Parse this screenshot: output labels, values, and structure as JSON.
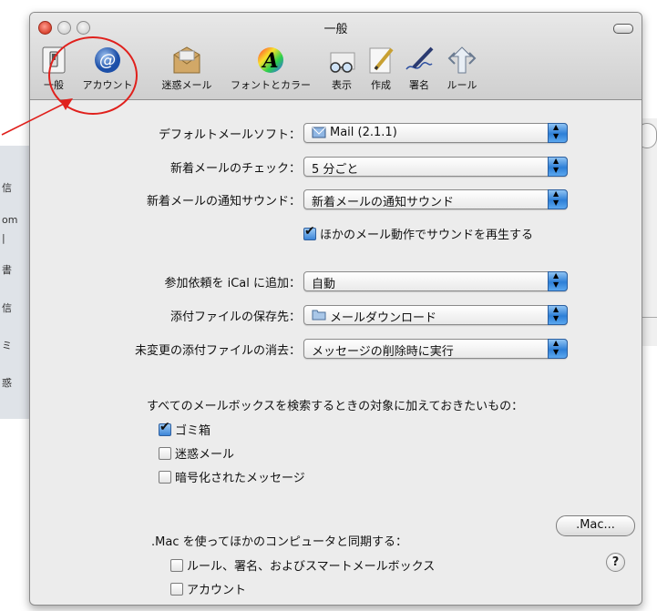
{
  "window": {
    "title": "一般"
  },
  "toolbar": {
    "items": [
      {
        "label": "一般",
        "icon": "general-switch-icon"
      },
      {
        "label": "アカウント",
        "icon": "at-sign-icon"
      },
      {
        "label": "迷惑メール",
        "icon": "junk-mail-icon"
      },
      {
        "label": "フォントとカラー",
        "icon": "fonts-colors-icon"
      },
      {
        "label": "表示",
        "icon": "viewing-glasses-icon"
      },
      {
        "label": "作成",
        "icon": "composing-pencil-icon"
      },
      {
        "label": "署名",
        "icon": "signature-pen-icon"
      },
      {
        "label": "ルール",
        "icon": "rules-arrows-icon"
      }
    ]
  },
  "settings": {
    "default_mail": {
      "label": "デフォルトメールソフト：",
      "value": "Mail (2.1.1)"
    },
    "check_mail": {
      "label": "新着メールのチェック：",
      "value": "5 分ごと"
    },
    "new_mail_sound": {
      "label": "新着メールの通知サウンド：",
      "value": "新着メールの通知サウンド"
    },
    "play_sounds": {
      "label": "ほかのメール動作でサウンドを再生する",
      "checked": true
    },
    "add_invitations": {
      "label": "参加依頼を iCal に追加：",
      "value": "自動"
    },
    "downloads_folder": {
      "label": "添付ファイルの保存先：",
      "value": "メールダウンロード"
    },
    "remove_unedited": {
      "label": "未変更の添付ファイルの消去：",
      "value": "メッセージの削除時に実行"
    }
  },
  "search": {
    "heading": "すべてのメールボックスを検索するときの対象に加えておきたいもの：",
    "options": [
      {
        "label": "ゴミ箱",
        "checked": true
      },
      {
        "label": "迷惑メール",
        "checked": false
      },
      {
        "label": "暗号化されたメッセージ",
        "checked": false
      }
    ]
  },
  "sync": {
    "heading": ".Mac を使ってほかのコンピュータと同期する：",
    "button": ".Mac...",
    "options": [
      {
        "label": "ルール、署名、およびスマートメールボックス",
        "checked": false
      },
      {
        "label": "アカウント",
        "checked": false
      }
    ]
  },
  "help": {
    "label": "?"
  },
  "background_window": {
    "fragments": [
      "信",
      "om",
      "|",
      "書",
      "信",
      "ミ",
      "惑"
    ]
  },
  "colors": {
    "annotation": "#e0201c",
    "stepper_blue": "#2d7fd7",
    "window_bg": "#ececec"
  }
}
